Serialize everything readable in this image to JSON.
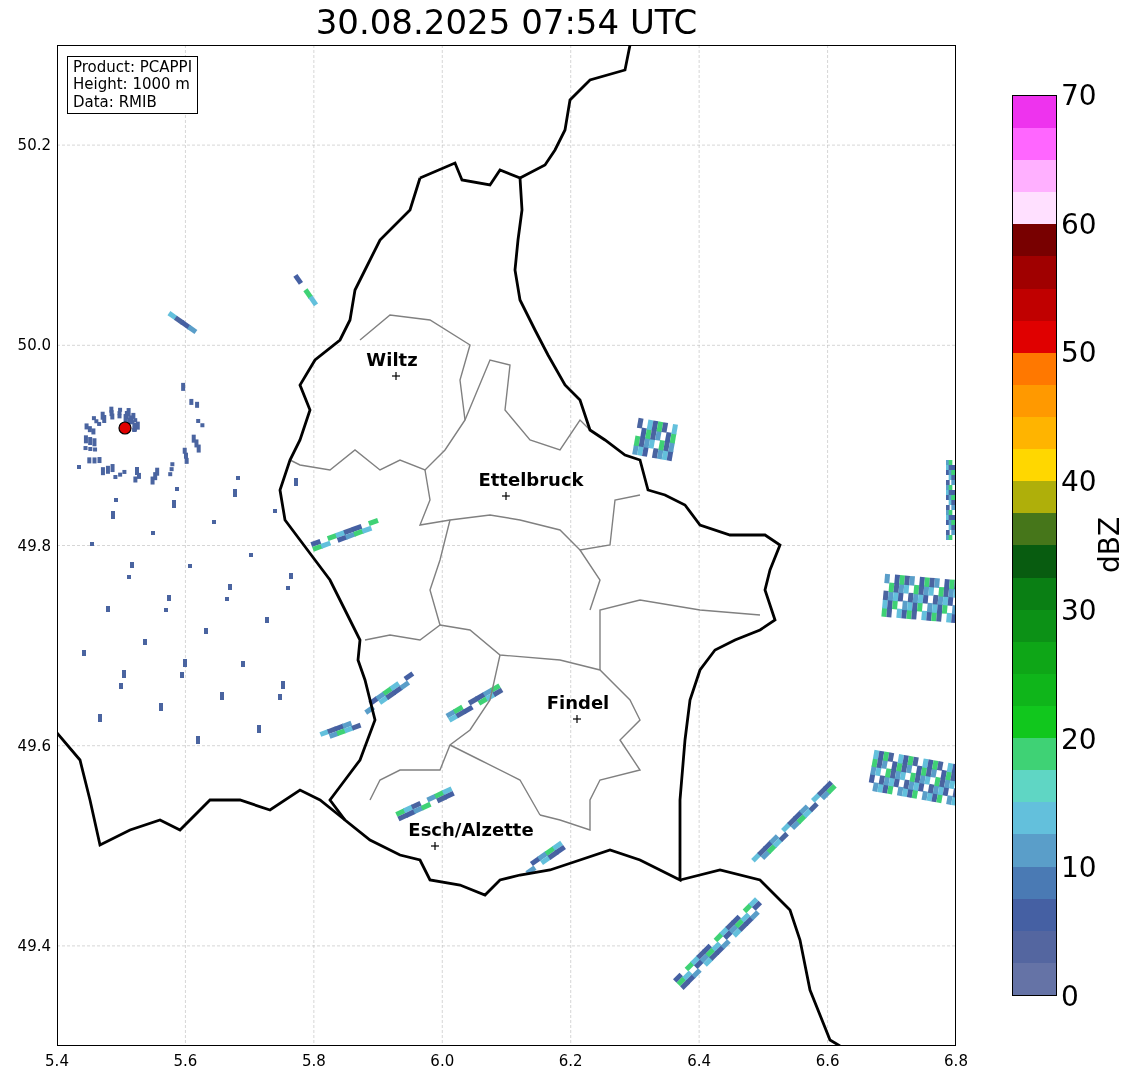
{
  "title": "30.08.2025 07:54 UTC",
  "info_box": [
    "Product: PCAPPI",
    "Height: 1000 m",
    "Data: RMIB"
  ],
  "map": {
    "x_ticks": [
      "5.4",
      "5.6",
      "5.8",
      "6.0",
      "6.2",
      "6.4",
      "6.6",
      "6.8"
    ],
    "y_ticks": [
      "50.2",
      "50.0",
      "49.8",
      "49.6",
      "49.4"
    ],
    "cities": [
      {
        "name": "Wiltz"
      },
      {
        "name": "Ettelbruck"
      },
      {
        "name": "Findel"
      },
      {
        "name": "Esch/Alzette"
      }
    ]
  },
  "colorbar": {
    "label": "dBZ",
    "ticks": [
      "70",
      "60",
      "50",
      "40",
      "30",
      "20",
      "10",
      "0"
    ],
    "bands": [
      {
        "color": "#6573a6"
      },
      {
        "color": "#5466a0"
      },
      {
        "color": "#4560a3"
      },
      {
        "color": "#4a7ab4"
      },
      {
        "color": "#5a9ec9"
      },
      {
        "color": "#63c0dc"
      },
      {
        "color": "#5fd6c4"
      },
      {
        "color": "#3fd275"
      },
      {
        "color": "#11c71d"
      },
      {
        "color": "#0fb51a"
      },
      {
        "color": "#0ea617"
      },
      {
        "color": "#0c9116"
      },
      {
        "color": "#0a7f14"
      },
      {
        "color": "#085c10"
      },
      {
        "color": "#46761a"
      },
      {
        "color": "#afaf0a"
      },
      {
        "color": "#ffd700"
      },
      {
        "color": "#ffb400"
      },
      {
        "color": "#ff9900"
      },
      {
        "color": "#ff7800"
      },
      {
        "color": "#e00000"
      },
      {
        "color": "#c00000"
      },
      {
        "color": "#a00000"
      },
      {
        "color": "#780000"
      },
      {
        "color": "#ffe0ff"
      },
      {
        "color": "#ffb0ff"
      },
      {
        "color": "#ff66ff"
      },
      {
        "color": "#ee33ee"
      }
    ]
  }
}
